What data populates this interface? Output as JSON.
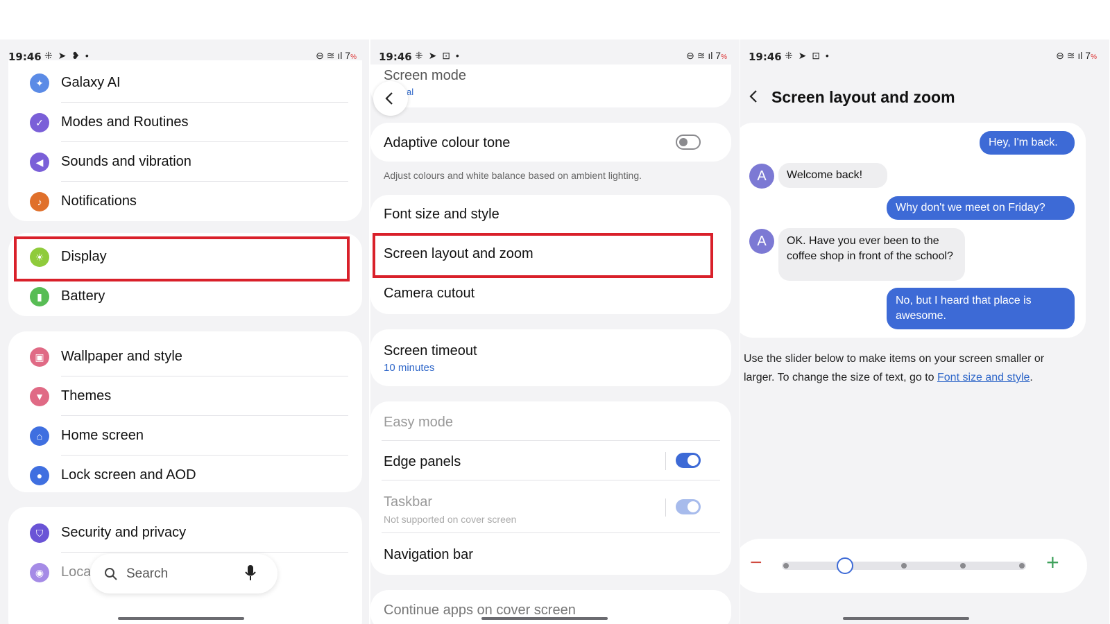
{
  "status_bar": {
    "time": "19:46",
    "left_icons": "⁜ ➤ ❥ •",
    "left_icons_2": "⁜ ➤ ⊡ •",
    "battery_num": "7",
    "battery_pct": "%"
  },
  "panel1": {
    "items": [
      {
        "label": "Galaxy AI",
        "icon": "sparkle-icon",
        "color": "#5b8be6"
      },
      {
        "label": "Modes and Routines",
        "icon": "check-circle-icon",
        "color": "#7a5fd8"
      },
      {
        "label": "Sounds and vibration",
        "icon": "speaker-icon",
        "color": "#7a5fd8"
      },
      {
        "label": "Notifications",
        "icon": "bell-icon",
        "color": "#e0702b"
      },
      {
        "label": "Display",
        "icon": "sun-icon",
        "color": "#8fcb3b"
      },
      {
        "label": "Battery",
        "icon": "battery-icon",
        "color": "#58bd55"
      },
      {
        "label": "Wallpaper and style",
        "icon": "image-icon",
        "color": "#e06a85"
      },
      {
        "label": "Themes",
        "icon": "brush-icon",
        "color": "#e06a85"
      },
      {
        "label": "Home screen",
        "icon": "home-icon",
        "color": "#3f6fe0"
      },
      {
        "label": "Lock screen and AOD",
        "icon": "lock-icon",
        "color": "#3f6fe0"
      },
      {
        "label": "Security and privacy",
        "icon": "shield-icon",
        "color": "#6a54d6"
      },
      {
        "label": "Locati",
        "icon": "location-icon",
        "color": "#a58be6"
      }
    ],
    "search_placeholder": "Search"
  },
  "panel2": {
    "screen_mode_label": "Screen mode",
    "screen_mode_value": "al",
    "adaptive_label": "Adaptive colour tone",
    "adaptive_on": false,
    "adaptive_desc": "Adjust colours and white balance based on ambient lighting.",
    "font_size_label": "Font size and style",
    "screen_layout_label": "Screen layout and zoom",
    "camera_cutout_label": "Camera cutout",
    "timeout_label": "Screen timeout",
    "timeout_value": "10 minutes",
    "easy_mode_label": "Easy mode",
    "edge_panels_label": "Edge panels",
    "edge_panels_on": true,
    "taskbar_label": "Taskbar",
    "taskbar_sub": "Not supported on cover screen",
    "taskbar_on": true,
    "nav_bar_label": "Navigation bar",
    "continue_label": "Continue apps on cover screen"
  },
  "panel3": {
    "title": "Screen layout and zoom",
    "messages": [
      {
        "from": "me",
        "text": "Hey, I'm back."
      },
      {
        "from": "A",
        "text": "Welcome back!"
      },
      {
        "from": "me",
        "text": "Why don't we meet on Friday?"
      },
      {
        "from": "A",
        "text": "OK. Have you ever been to the coffee shop in front of the school?"
      },
      {
        "from": "me",
        "text": "No, but I heard that place is awesome."
      }
    ],
    "avatar_letter": "A",
    "hint_prefix": "Use the slider below to make items on your screen smaller or larger. To change the size of text, go to ",
    "hint_link": "Font size and style",
    "hint_suffix": ".",
    "slider_steps": 5,
    "slider_value": 2,
    "minus": "−",
    "plus": "+"
  }
}
